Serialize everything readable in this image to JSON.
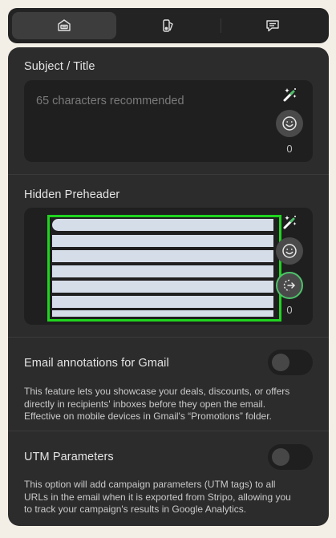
{
  "tabs": [
    {
      "icon": "email-settings-icon",
      "active": true
    },
    {
      "icon": "design-palette-icon",
      "active": false
    },
    {
      "icon": "comments-icon",
      "active": false
    }
  ],
  "subject": {
    "label": "Subject / Title",
    "placeholder": "65 characters recommended",
    "counter": "0",
    "icons": [
      "magic-wand-icon",
      "emoji-icon"
    ]
  },
  "preheader": {
    "label": "Hidden Preheader",
    "counter": "0",
    "icons": [
      "magic-wand-icon",
      "emoji-icon",
      "merge-tag-icon"
    ]
  },
  "gmail": {
    "label": "Email annotations for Gmail",
    "enabled": false,
    "description_lines": [
      "This feature lets you showcase your deals, discounts, or offers",
      "directly in recipients' inboxes before they open the email.",
      "Effective on mobile devices in Gmail's “Promotions” folder."
    ]
  },
  "utm": {
    "label": "UTM Parameters",
    "enabled": false,
    "description_lines": [
      "This option will add campaign parameters (UTM tags) to all",
      "URLs in the email when it is exported from Stripo, allowing you",
      "to track your campaign's results in Google Analytics."
    ]
  },
  "colors": {
    "accent_green": "#4ec26a",
    "panel": "#2c2c2c",
    "field": "#1f1f1f"
  }
}
